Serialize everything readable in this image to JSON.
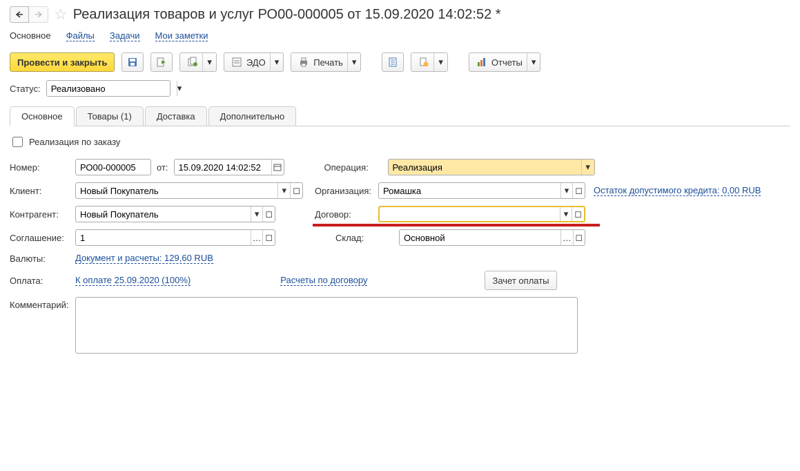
{
  "header": {
    "title": "Реализация товаров и услуг РО00-000005 от 15.09.2020 14:02:52 *"
  },
  "nav": {
    "main": "Основное",
    "files": "Файлы",
    "tasks": "Задачи",
    "notes": "Мои заметки"
  },
  "toolbar": {
    "post_close": "Провести и закрыть",
    "edo": "ЭДО",
    "print": "Печать",
    "reports": "Отчеты"
  },
  "status": {
    "label": "Статус:",
    "value": "Реализовано"
  },
  "tabs": {
    "main": "Основное",
    "goods": "Товары (1)",
    "delivery": "Доставка",
    "extra": "Дополнительно"
  },
  "form": {
    "byorder_label": "Реализация по заказу",
    "number_label": "Номер:",
    "number_value": "РО00-000005",
    "from_label": "от:",
    "date_value": "15.09.2020 14:02:52",
    "operation_label": "Операция:",
    "operation_value": "Реализация",
    "client_label": "Клиент:",
    "client_value": "Новый Покупатель",
    "org_label": "Организация:",
    "org_value": "Ромашка",
    "credit_link": "Остаток допустимого кредита: 0,00 RUB",
    "counterparty_label": "Контрагент:",
    "counterparty_value": "Новый Покупатель",
    "contract_label": "Договор:",
    "contract_value": "",
    "agreement_label": "Соглашение:",
    "agreement_value": "1",
    "warehouse_label": "Склад:",
    "warehouse_value": "Основной",
    "currency_label": "Валюты:",
    "currency_link": "Документ и расчеты: 129,60 RUB",
    "payment_label": "Оплата:",
    "payment_link": "К оплате 25.09.2020 (100%)",
    "calc_link": "Расчеты по договору",
    "offset_btn": "Зачет оплаты",
    "comment_label": "Комментарий:",
    "comment_value": ""
  }
}
